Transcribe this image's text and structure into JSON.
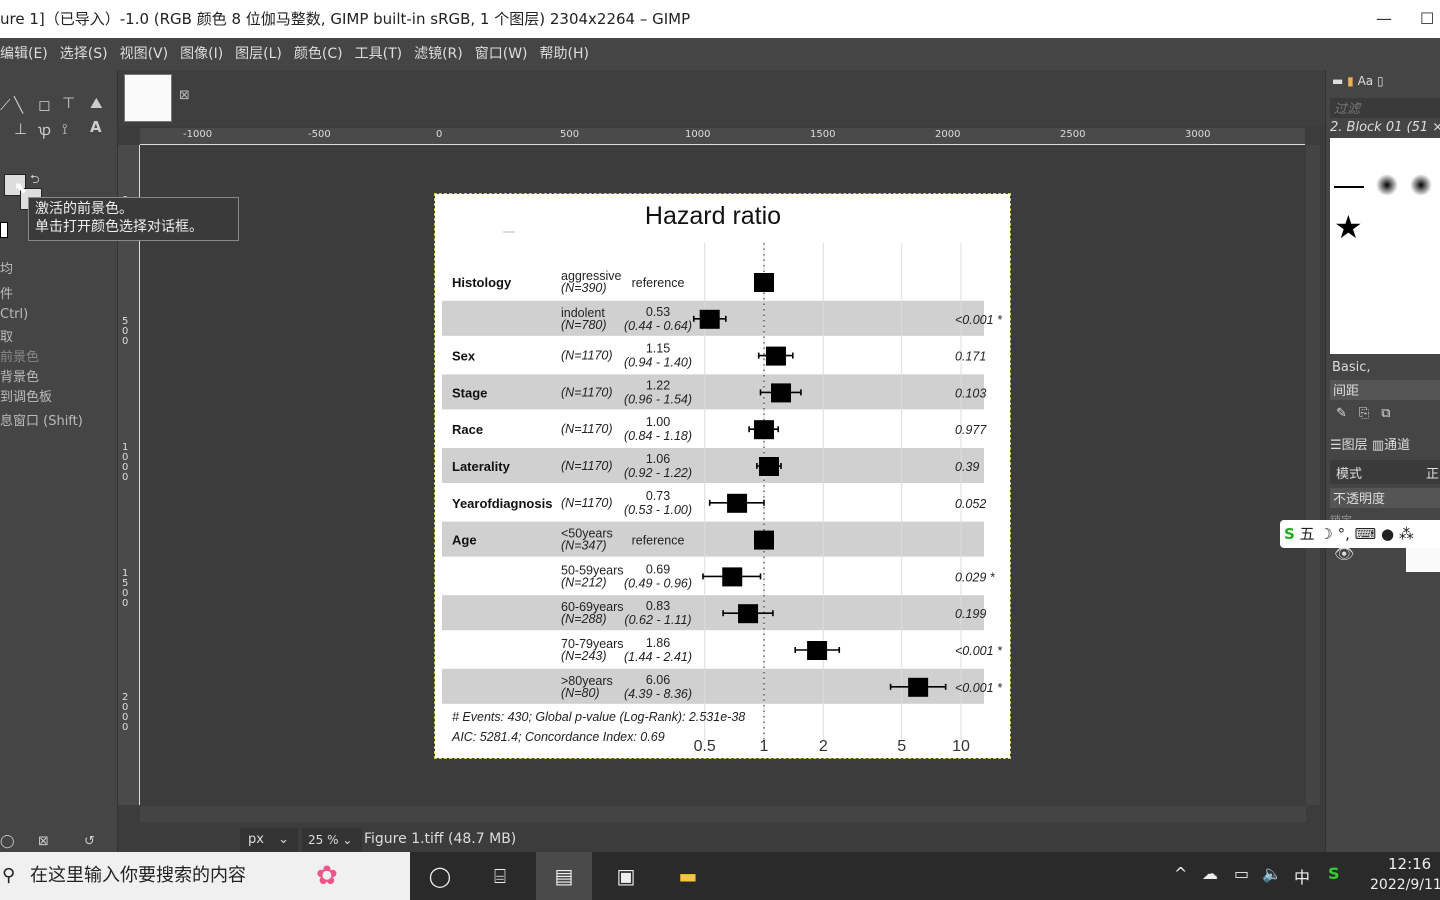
{
  "window": {
    "title": "ure 1]（已导入）-1.0 (RGB 颜色 8 位伽马整数, GIMP built-in sRGB, 1 个图层) 2304x2264 – GIMP",
    "minimize": "—",
    "maximize": "☐"
  },
  "menu": [
    "编辑(E)",
    "选择(S)",
    "视图(V)",
    "图像(I)",
    "图层(L)",
    "颜色(C)",
    "工具(T)",
    "滤镜(R)",
    "窗口(W)",
    "帮助(H)"
  ],
  "tooltip": {
    "line1": "激活的前景色。",
    "line2": "单击打开颜色选择对话框。"
  },
  "tool_options": [
    "均",
    "件",
    "Ctrl)",
    "取",
    "前景色",
    "背景色",
    "到调色板",
    "息窗口 (Shift)"
  ],
  "ruler_top": [
    "-1000",
    "-500",
    "0",
    "500",
    "1000",
    "1500",
    "2000",
    "2500",
    "3000"
  ],
  "ruler_left": [
    "0",
    "500",
    "1000",
    "1500",
    "2000"
  ],
  "status": {
    "unit": "px",
    "zoom": "25 %",
    "file": "Figure 1.tiff (48.7 MB)"
  },
  "right_panel": {
    "filter_placeholder": "过滤",
    "brush_name": "2. Block 01 (51 ×",
    "brush_tag": "Basic,",
    "spacing_label": "间距",
    "tab_layers": "图层",
    "tab_channels": "通道",
    "mode_label": "模式",
    "mode_value": "正",
    "opacity_label": "不透明度",
    "lock_label": "锁定"
  },
  "ime_bar": "五",
  "taskbar": {
    "search_placeholder": "在这里输入你要搜索的内容",
    "time": "12:16",
    "date": "2022/9/11",
    "ime": "中"
  },
  "chart_data": {
    "type": "forest",
    "title": "Hazard ratio",
    "x_scale": "log",
    "xticks": [
      0.5,
      1,
      2,
      5,
      10
    ],
    "xtick_labels": [
      "0.5",
      "1",
      "2",
      "5",
      "10"
    ],
    "reference_line": 1,
    "rows": [
      {
        "var": "Histology",
        "level": "aggressive",
        "n": "(N=390)",
        "hr": 1,
        "hr_text": "reference",
        "ci_text": "",
        "lo": null,
        "hi": null,
        "p": "",
        "shaded": false
      },
      {
        "var": "",
        "level": "indolent",
        "n": "(N=780)",
        "hr": 0.53,
        "hr_text": "0.53",
        "ci_text": "(0.44 - 0.64)",
        "lo": 0.44,
        "hi": 0.64,
        "p": "<0.001 *",
        "shaded": true
      },
      {
        "var": "Sex",
        "level": "",
        "n": "(N=1170)",
        "hr": 1.15,
        "hr_text": "1.15",
        "ci_text": "(0.94 - 1.40)",
        "lo": 0.94,
        "hi": 1.4,
        "p": "0.171",
        "shaded": false
      },
      {
        "var": "Stage",
        "level": "",
        "n": "(N=1170)",
        "hr": 1.22,
        "hr_text": "1.22",
        "ci_text": "(0.96 - 1.54)",
        "lo": 0.96,
        "hi": 1.54,
        "p": "0.103",
        "shaded": true
      },
      {
        "var": "Race",
        "level": "",
        "n": "(N=1170)",
        "hr": 1.0,
        "hr_text": "1.00",
        "ci_text": "(0.84 - 1.18)",
        "lo": 0.84,
        "hi": 1.18,
        "p": "0.977",
        "shaded": false
      },
      {
        "var": "Laterality",
        "level": "",
        "n": "(N=1170)",
        "hr": 1.06,
        "hr_text": "1.06",
        "ci_text": "(0.92 - 1.22)",
        "lo": 0.92,
        "hi": 1.22,
        "p": "0.39",
        "shaded": true
      },
      {
        "var": "Yearofdiagnosis",
        "level": "",
        "n": "(N=1170)",
        "hr": 0.73,
        "hr_text": "0.73",
        "ci_text": "(0.53 - 1.00)",
        "lo": 0.53,
        "hi": 1.0,
        "p": "0.052",
        "shaded": false
      },
      {
        "var": "Age",
        "level": "<50years",
        "n": "(N=347)",
        "hr": 1,
        "hr_text": "reference",
        "ci_text": "",
        "lo": null,
        "hi": null,
        "p": "",
        "shaded": true
      },
      {
        "var": "",
        "level": "50-59years",
        "n": "(N=212)",
        "hr": 0.69,
        "hr_text": "0.69",
        "ci_text": "(0.49 - 0.96)",
        "lo": 0.49,
        "hi": 0.96,
        "p": "0.029 *",
        "shaded": false
      },
      {
        "var": "",
        "level": "60-69years",
        "n": "(N=288)",
        "hr": 0.83,
        "hr_text": "0.83",
        "ci_text": "(0.62 - 1.11)",
        "lo": 0.62,
        "hi": 1.11,
        "p": "0.199",
        "shaded": true
      },
      {
        "var": "",
        "level": "70-79years",
        "n": "(N=243)",
        "hr": 1.86,
        "hr_text": "1.86",
        "ci_text": "(1.44 - 2.41)",
        "lo": 1.44,
        "hi": 2.41,
        "p": "<0.001 *",
        "shaded": false
      },
      {
        "var": "",
        "level": ">80years",
        "n": "(N=80)",
        "hr": 6.06,
        "hr_text": "6.06",
        "ci_text": "(4.39 - 8.36)",
        "lo": 4.39,
        "hi": 8.36,
        "p": "<0.001 *",
        "shaded": true
      }
    ],
    "footer": [
      "# Events: 430; Global p-value (Log-Rank): 2.531e-38",
      "AIC: 5281.4; Concordance Index: 0.69"
    ],
    "colors": {
      "shade": "#d0d0d0",
      "marker": "#000000"
    }
  }
}
